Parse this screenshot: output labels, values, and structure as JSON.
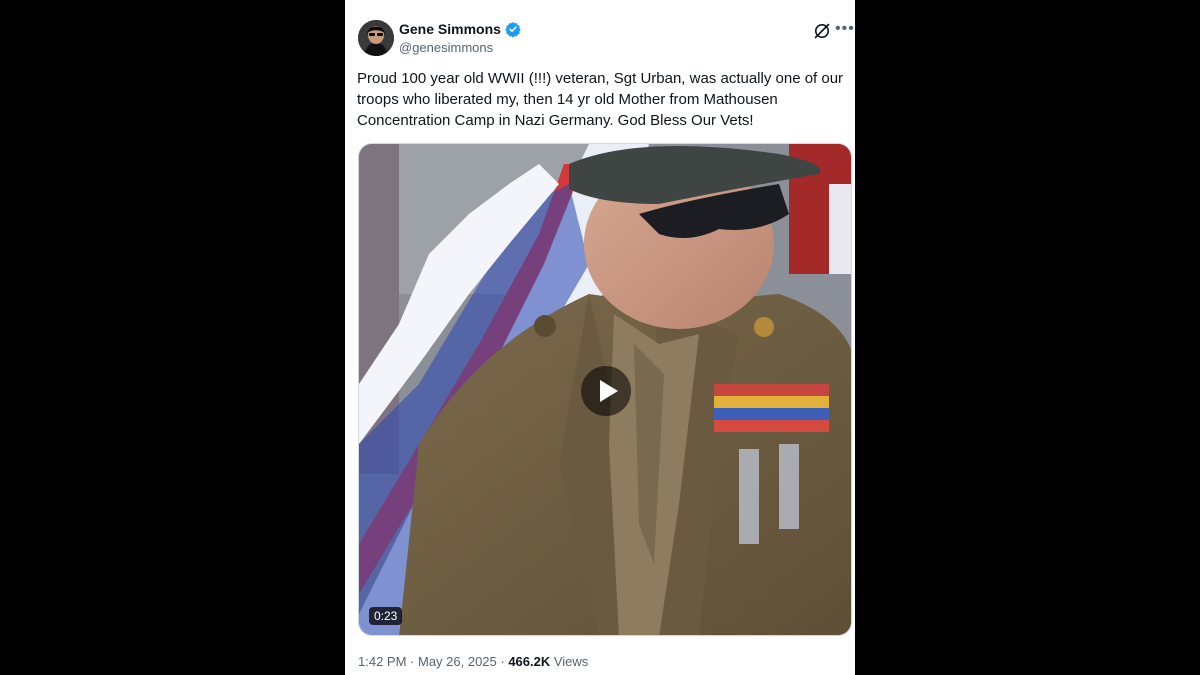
{
  "author": {
    "display_name": "Gene Simmons",
    "handle": "@genesimmons",
    "verified": true
  },
  "tweet": {
    "text": "Proud 100 year old WWII (!!!) veteran, Sgt Urban, was actually one of our\ntroops who liberated my, then 14 yr old Mother from Mathousen\nConcentration Camp in  Nazi Germany. God Bless Our Vets!"
  },
  "media": {
    "type": "video",
    "duration": "0:23",
    "play_icon": "play-icon"
  },
  "meta": {
    "time": "1:42 PM",
    "separator1": " · ",
    "date": "May 26, 2025",
    "separator2": " · ",
    "views_count": "466.2K",
    "views_label": " Views"
  },
  "icons": {
    "verified": "verified-badge-icon",
    "grok": "grok-icon",
    "more": "more-icon"
  },
  "colors": {
    "accent": "#1d9bf0",
    "text_primary": "#0f1419",
    "text_secondary": "#536471",
    "page_background": "#000000",
    "card_background": "#ffffff"
  }
}
